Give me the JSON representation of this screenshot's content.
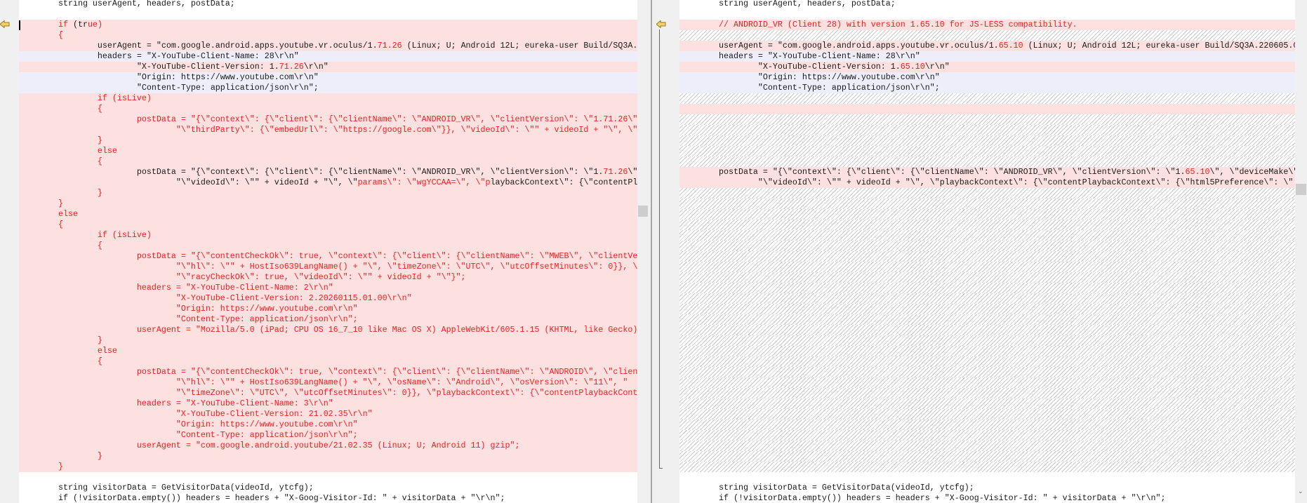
{
  "colors": {
    "removed_bg": "#fde1e1",
    "moved_bg": "#eeeefb",
    "diff_text": "#f41c1c",
    "text": "#1a1a1a"
  },
  "left": {
    "lines": [
      {
        "bg": "w",
        "s": [
          [
            "\tstring userAgent, headers, postData;",
            "k"
          ]
        ]
      },
      {
        "bg": "w",
        "s": []
      },
      {
        "bg": "p",
        "s": [
          [
            "\tif",
            "r"
          ],
          [
            " (tr",
            "k"
          ],
          [
            "ue)",
            "r"
          ]
        ]
      },
      {
        "bg": "p",
        "s": [
          [
            "\t{",
            "r"
          ]
        ]
      },
      {
        "bg": "p",
        "s": [
          [
            "\t\tuserAgent = \"com.google.android.apps.youtube.vr.oculus/1.",
            "k"
          ],
          [
            "71.26",
            "r"
          ],
          [
            " (Linux; U; Android 12L; eureka-user Build/SQ3A.",
            "k"
          ]
        ]
      },
      {
        "bg": "b",
        "s": [
          [
            "\t\theaders = \"X-YouTube-Client-Name: 28\\r\\n\"",
            "k"
          ]
        ]
      },
      {
        "bg": "p",
        "s": [
          [
            "\t\t\t\"X-YouTube-Client-Version: 1.",
            "k"
          ],
          [
            "71.26",
            "r"
          ],
          [
            "\\r\\n\"",
            "k"
          ]
        ]
      },
      {
        "bg": "b",
        "s": [
          [
            "\t\t\t\"Origin: https://www.youtube.com\\r\\n\"",
            "k"
          ]
        ]
      },
      {
        "bg": "b",
        "s": [
          [
            "\t\t\t\"Content-Type: application/json\\r\\n\";",
            "k"
          ]
        ]
      },
      {
        "bg": "p",
        "s": [
          [
            "\t\tif (isLive)",
            "r"
          ]
        ]
      },
      {
        "bg": "p",
        "s": [
          [
            "\t\t{",
            "r"
          ]
        ]
      },
      {
        "bg": "p",
        "s": [
          [
            "\t\t\tpostData = \"{\\\"context\\\": {\\\"client\\\": {\\\"clientName\\\": \\\"ANDROID_VR\\\", \\\"clientVersion\\\": \\\"1.71.26\\\"",
            "r"
          ]
        ]
      },
      {
        "bg": "p",
        "s": [
          [
            "\t\t\t\t\"\\\"thirdParty\\\": {\\\"embedUrl\\\": \\\"https://google.com\\\"}}, \\\"videoId\\\": \\\"\" + videoId + \"\\\", \\\"",
            "r"
          ]
        ]
      },
      {
        "bg": "p",
        "s": [
          [
            "\t\t}",
            "r"
          ]
        ]
      },
      {
        "bg": "p",
        "s": [
          [
            "\t\telse",
            "r"
          ]
        ]
      },
      {
        "bg": "p",
        "s": [
          [
            "\t\t{",
            "r"
          ]
        ]
      },
      {
        "bg": "p",
        "s": [
          [
            "\t\t\tpostData = \"{\\\"context\\\": {\\\"client\\\": {\\\"clientName\\\": \\\"ANDROID_VR\\\", \\\"clientVersion\\\": \\\"1.",
            "k"
          ],
          [
            "71.26",
            "r"
          ],
          [
            "\\\"",
            "k"
          ]
        ]
      },
      {
        "bg": "p",
        "s": [
          [
            "\t\t\t\t\"\\\"videoId\\\": \\\"\" + videoId + \"\\\", \\\"",
            "k"
          ],
          [
            "params\\\": \\\"wgYCCAA=\\\", \\\"p",
            "r"
          ],
          [
            "laybackContext\\\": {\\\"contentPl",
            "k"
          ]
        ]
      },
      {
        "bg": "p",
        "s": [
          [
            "\t\t}",
            "r"
          ]
        ]
      },
      {
        "bg": "p",
        "s": [
          [
            "\t}",
            "r"
          ]
        ]
      },
      {
        "bg": "p",
        "s": [
          [
            "\telse",
            "r"
          ]
        ]
      },
      {
        "bg": "p",
        "s": [
          [
            "\t{",
            "r"
          ]
        ]
      },
      {
        "bg": "p",
        "s": [
          [
            "\t\tif (isLive)",
            "r"
          ]
        ]
      },
      {
        "bg": "p",
        "s": [
          [
            "\t\t{",
            "r"
          ]
        ]
      },
      {
        "bg": "p",
        "s": [
          [
            "\t\t\tpostData = \"{\\\"contentCheckOk\\\": true, \\\"context\\\": {\\\"client\\\": {\\\"clientName\\\": \\\"MWEB\\\", \\\"clientVe",
            "r"
          ]
        ]
      },
      {
        "bg": "p",
        "s": [
          [
            "\t\t\t\t\"\\\"hl\\\": \\\"\" + HostIso639LangName() + \"\\\", \\\"timeZone\\\": \\\"UTC\\\", \\\"utcOffsetMinutes\\\": 0}}, \\",
            "r"
          ]
        ]
      },
      {
        "bg": "p",
        "s": [
          [
            "\t\t\t\t\"\\\"racyCheckOk\\\": true, \\\"videoId\\\": \\\"\" + videoId + \"\\\"}\";",
            "r"
          ]
        ]
      },
      {
        "bg": "p",
        "s": [
          [
            "\t\t\theaders = \"X-YouTube-Client-Name: 2\\r\\n\"",
            "r"
          ]
        ]
      },
      {
        "bg": "p",
        "s": [
          [
            "\t\t\t\t\"X-YouTube-Client-Version: 2.20260115.01.00\\r\\n\"",
            "r"
          ]
        ]
      },
      {
        "bg": "p",
        "s": [
          [
            "\t\t\t\t\"Origin: https://www.youtube.com\\r\\n\"",
            "r"
          ]
        ]
      },
      {
        "bg": "p",
        "s": [
          [
            "\t\t\t\t\"Content-Type: application/json\\r\\n\";",
            "r"
          ]
        ]
      },
      {
        "bg": "p",
        "s": [
          [
            "\t\t\tuserAgent = \"Mozilla/5.0 (iPad; CPU OS 16_7_10 like Mac OS X) AppleWebKit/605.1.15 (KHTML, like Gecko)",
            "r"
          ]
        ]
      },
      {
        "bg": "p",
        "s": [
          [
            "\t\t}",
            "r"
          ]
        ]
      },
      {
        "bg": "p",
        "s": [
          [
            "\t\telse",
            "r"
          ]
        ]
      },
      {
        "bg": "p",
        "s": [
          [
            "\t\t{",
            "r"
          ]
        ]
      },
      {
        "bg": "p",
        "s": [
          [
            "\t\t\tpostData = \"{\\\"contentCheckOk\\\": true, \\\"context\\\": {\\\"client\\\": {\\\"clientName\\\": \\\"ANDROID\\\", \\\"clien",
            "r"
          ]
        ]
      },
      {
        "bg": "p",
        "s": [
          [
            "\t\t\t\t\"\\\"hl\\\": \\\"\" + HostIso639LangName() + \"\\\", \\\"osName\\\": \\\"Android\\\", \\\"osVersion\\\": \\\"11\\\", \"",
            "r"
          ]
        ]
      },
      {
        "bg": "p",
        "s": [
          [
            "\t\t\t\t\"\\\"timeZone\\\": \\\"UTC\\\", \\\"utcOffsetMinutes\\\": 0}}, \\\"playbackContext\\\": {\\\"contentPlaybackCont",
            "r"
          ]
        ]
      },
      {
        "bg": "p",
        "s": [
          [
            "\t\t\theaders = \"X-YouTube-Client-Name: 3\\r\\n\"",
            "r"
          ]
        ]
      },
      {
        "bg": "p",
        "s": [
          [
            "\t\t\t\t\"X-YouTube-Client-Version: 21.02.35\\r\\n\"",
            "r"
          ]
        ]
      },
      {
        "bg": "p",
        "s": [
          [
            "\t\t\t\t\"Origin: https://www.youtube.com\\r\\n\"",
            "r"
          ]
        ]
      },
      {
        "bg": "p",
        "s": [
          [
            "\t\t\t\t\"Content-Type: application/json\\r\\n\";",
            "r"
          ]
        ]
      },
      {
        "bg": "p",
        "s": [
          [
            "\t\t\tuserAgent = \"com.google.android.youtube/21.02.35 (Linux; U; Android 11) gzip\";",
            "r"
          ]
        ]
      },
      {
        "bg": "p",
        "s": [
          [
            "\t\t}",
            "r"
          ]
        ]
      },
      {
        "bg": "p",
        "s": [
          [
            "\t}",
            "r"
          ]
        ]
      },
      {
        "bg": "w",
        "s": []
      },
      {
        "bg": "w",
        "s": [
          [
            "\tstring visitorData = GetVisitorData(videoId, ytcfg);",
            "k"
          ]
        ]
      },
      {
        "bg": "w",
        "s": [
          [
            "\tif (!visitorData.empty()) headers = headers + \"X-Goog-Visitor-Id: \" + visitorData + \"\\r\\n\";",
            "k"
          ]
        ]
      }
    ]
  },
  "right": {
    "lines": [
      {
        "bg": "w",
        "s": [
          [
            "\tstring userAgent, headers, postData;",
            "k"
          ]
        ]
      },
      {
        "bg": "w",
        "s": []
      },
      {
        "bg": "p",
        "s": [
          [
            "\t// ANDROID_VR (Client 28) with version 1.65.10 for JS-LESS compatibility.",
            "r"
          ]
        ]
      },
      {
        "bg": "h",
        "s": []
      },
      {
        "bg": "p",
        "s": [
          [
            "\tuserAgent = \"com.google.android.apps.youtube.vr.oculus/1.",
            "k"
          ],
          [
            "65.10",
            "r"
          ],
          [
            " (Linux; U; Android 12L; eureka-user Build/SQ3A.220605.0",
            "k"
          ]
        ]
      },
      {
        "bg": "b",
        "s": [
          [
            "\theaders = \"X-YouTube-Client-Name: 28\\r\\n\"",
            "k"
          ]
        ]
      },
      {
        "bg": "p",
        "s": [
          [
            "\t\t\"X-YouTube-Client-Version: 1.",
            "k"
          ],
          [
            "65.10",
            "r"
          ],
          [
            "\\r\\n\"",
            "k"
          ]
        ]
      },
      {
        "bg": "b",
        "s": [
          [
            "\t\t\"Origin: https://www.youtube.com\\r\\n\"",
            "k"
          ]
        ]
      },
      {
        "bg": "b",
        "s": [
          [
            "\t\t\"Content-Type: application/json\\r\\n\";",
            "k"
          ]
        ]
      },
      {
        "bg": "h",
        "s": []
      },
      {
        "bg": "p",
        "s": []
      },
      {
        "bg": "h",
        "s": []
      },
      {
        "bg": "h",
        "s": []
      },
      {
        "bg": "h",
        "s": []
      },
      {
        "bg": "h",
        "s": []
      },
      {
        "bg": "h",
        "s": []
      },
      {
        "bg": "p",
        "s": [
          [
            "\tpostData = \"{\\\"context\\\": {\\\"client\\\": {\\\"clientName\\\": \\\"ANDROID_VR\\\", \\\"clientVersion\\\": \\\"1.",
            "k"
          ],
          [
            "65.10",
            "r"
          ],
          [
            "\\\", \\\"deviceMake\\\"",
            "k"
          ]
        ]
      },
      {
        "bg": "p",
        "s": [
          [
            "\t\t\"\\\"videoId\\\": \\\"\" + videoId + \"\\\", \\\"playbackContext\\\": {\\\"contentPlaybackContext\\\": {\\\"html5Preference\\\": \\\"",
            "k"
          ]
        ]
      },
      {
        "bg": "h",
        "s": []
      },
      {
        "bg": "h",
        "s": []
      },
      {
        "bg": "h",
        "s": []
      },
      {
        "bg": "h",
        "s": []
      },
      {
        "bg": "h",
        "s": []
      },
      {
        "bg": "h",
        "s": []
      },
      {
        "bg": "h",
        "s": []
      },
      {
        "bg": "h",
        "s": []
      },
      {
        "bg": "h",
        "s": []
      },
      {
        "bg": "h",
        "s": []
      },
      {
        "bg": "h",
        "s": []
      },
      {
        "bg": "h",
        "s": []
      },
      {
        "bg": "h",
        "s": []
      },
      {
        "bg": "h",
        "s": []
      },
      {
        "bg": "h",
        "s": []
      },
      {
        "bg": "h",
        "s": []
      },
      {
        "bg": "h",
        "s": []
      },
      {
        "bg": "h",
        "s": []
      },
      {
        "bg": "h",
        "s": []
      },
      {
        "bg": "h",
        "s": []
      },
      {
        "bg": "h",
        "s": []
      },
      {
        "bg": "h",
        "s": []
      },
      {
        "bg": "h",
        "s": []
      },
      {
        "bg": "h",
        "s": []
      },
      {
        "bg": "h",
        "s": []
      },
      {
        "bg": "h",
        "s": []
      },
      {
        "bg": "h",
        "s": []
      },
      {
        "bg": "w",
        "s": []
      },
      {
        "bg": "w",
        "s": [
          [
            "\tstring visitorData = GetVisitorData(videoId, ytcfg);",
            "k"
          ]
        ]
      },
      {
        "bg": "w",
        "s": [
          [
            "\tif (!visitorData.empty()) headers = headers + \"X-Goog-Visitor-Id: \" + visitorData + \"\\r\\n\";",
            "k"
          ]
        ]
      }
    ]
  }
}
